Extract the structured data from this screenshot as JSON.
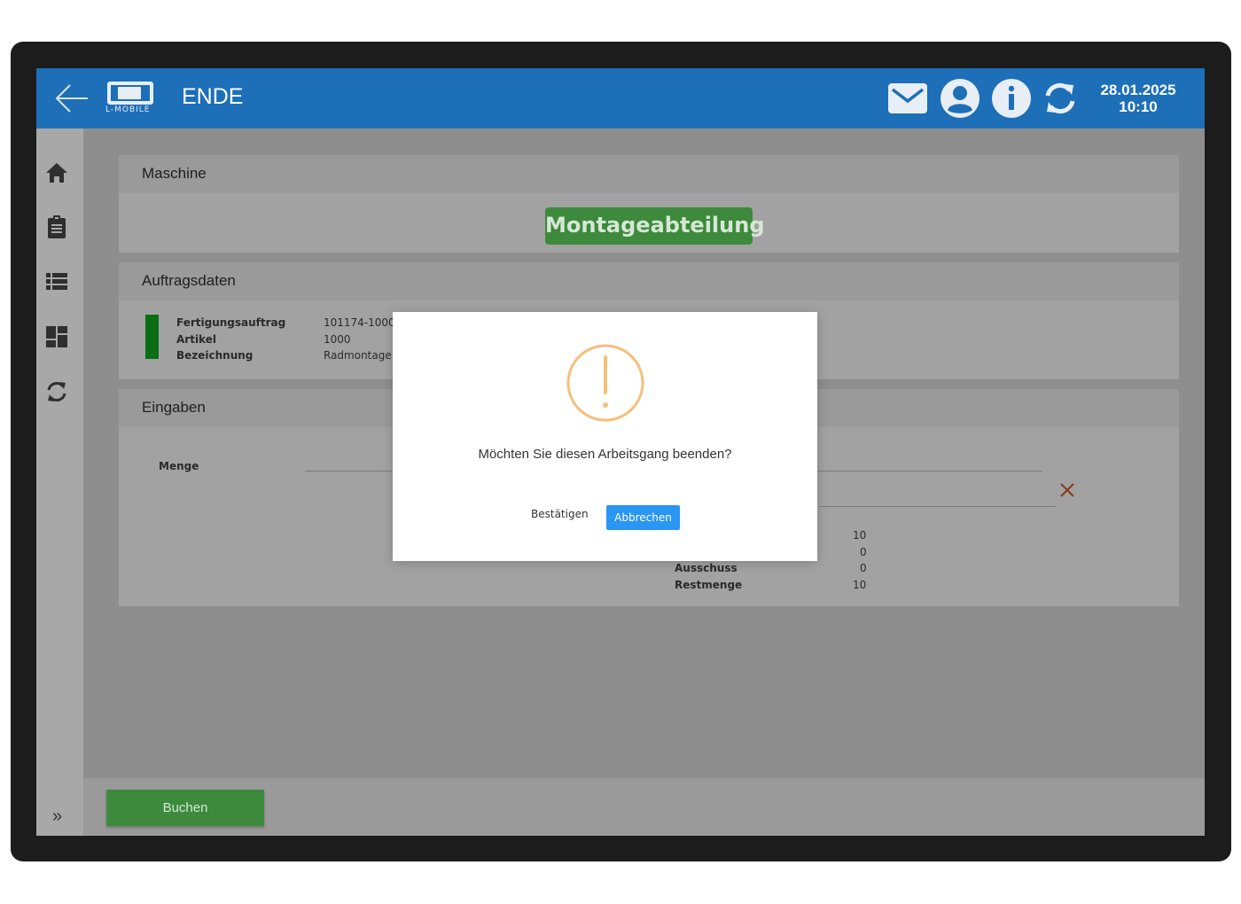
{
  "header": {
    "title": "ENDE",
    "logo_text": "L-MOBILE",
    "date": "28.01.2025",
    "time": "10:10",
    "icons": [
      "back-arrow-icon",
      "mail-icon",
      "user-icon",
      "info-icon",
      "sync-icon"
    ]
  },
  "sidebar": {
    "icons": [
      "home-icon",
      "clipboard-icon",
      "list-icon",
      "dashboard-icon",
      "sync-icon"
    ],
    "expand_label": "»"
  },
  "machine": {
    "heading": "Maschine",
    "name": "Montageabteilung"
  },
  "order": {
    "heading": "Auftragsdaten",
    "rows": [
      {
        "label": "Fertigungsauftrag",
        "value": "101174-1000"
      },
      {
        "label": "Artikel",
        "value": "1000"
      },
      {
        "label": "Bezeichnung",
        "value": "Radmontage"
      }
    ]
  },
  "inputs": {
    "heading": "Eingaben",
    "quantity_label": "Menge",
    "summary": [
      {
        "label": "",
        "value": "10"
      },
      {
        "label": "",
        "value": "0"
      },
      {
        "label": "Ausschuss",
        "value": "0"
      },
      {
        "label": "Restmenge",
        "value": "10"
      }
    ]
  },
  "footer": {
    "book_label": "Buchen"
  },
  "dialog": {
    "message": "Möchten Sie diesen Arbeitsgang beenden?",
    "confirm_label": "Bestätigen",
    "cancel_label": "Abbrechen",
    "icon": "warning-icon"
  },
  "colors": {
    "header": "#1d6fb8",
    "green": "#3d8a3d",
    "status_green": "#0a6e14",
    "cancel_blue": "#2a96f3",
    "warning_orange": "#f5c07a",
    "close_red": "#b5522a"
  }
}
